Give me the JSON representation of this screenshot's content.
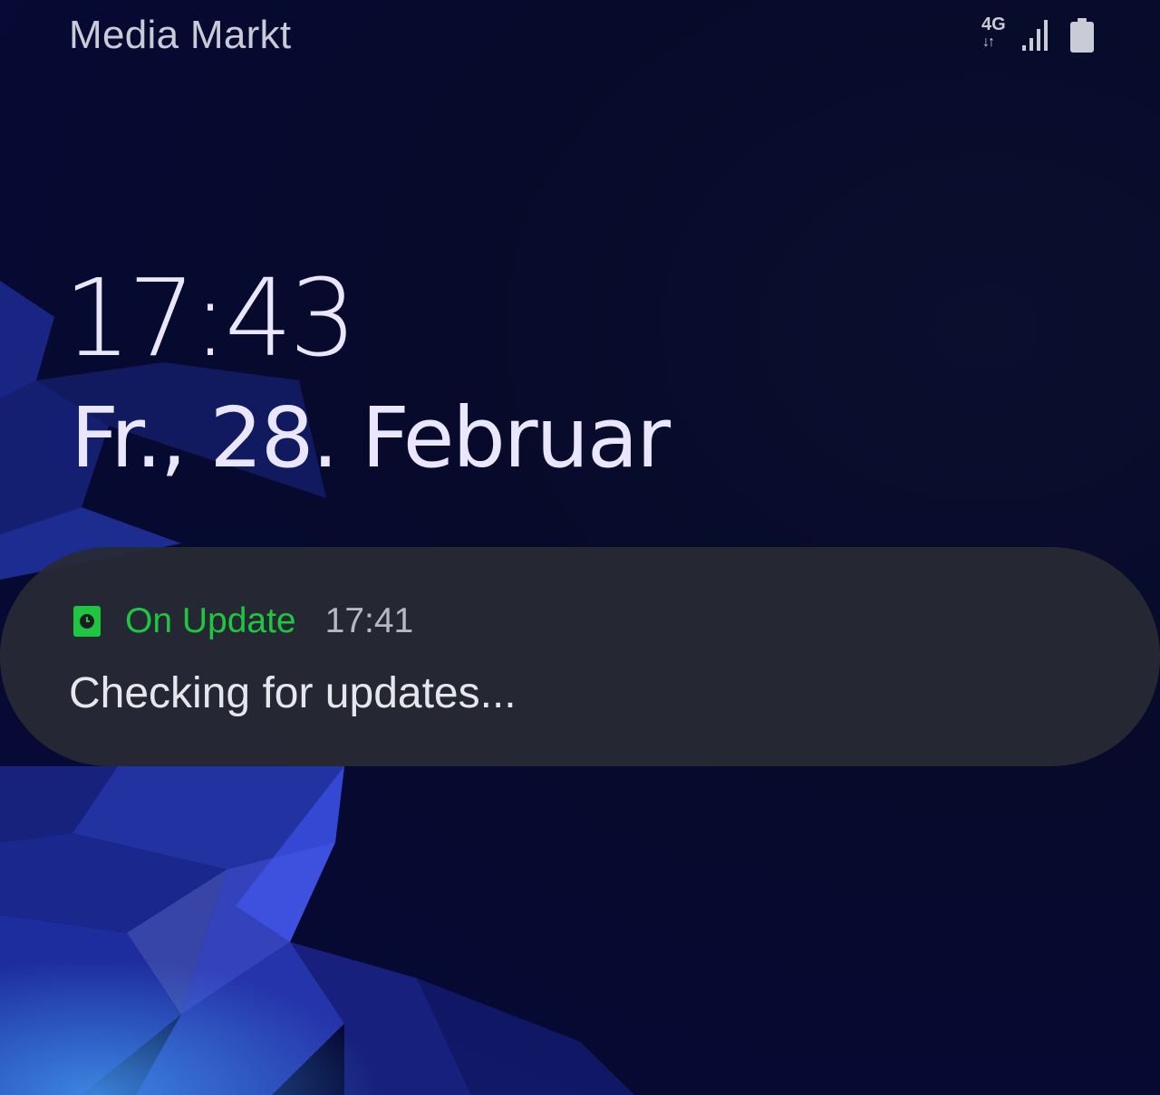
{
  "status_bar": {
    "carrier": "Media Markt",
    "network_type": "4G",
    "data_arrows": "↓↑",
    "signal_icon": "signal-bars-icon",
    "battery_icon": "battery-icon"
  },
  "lockscreen": {
    "time": "17:43",
    "date": "Fr., 28. Februar"
  },
  "notification": {
    "app_icon": "clock-app-icon",
    "app_name": "On Update",
    "time": "17:41",
    "text": "Checking for updates...",
    "app_color": "#1ec73f"
  },
  "colors": {
    "background": "#070a2a",
    "text_primary": "#eae6ff",
    "notification_bg": "#282a34"
  }
}
